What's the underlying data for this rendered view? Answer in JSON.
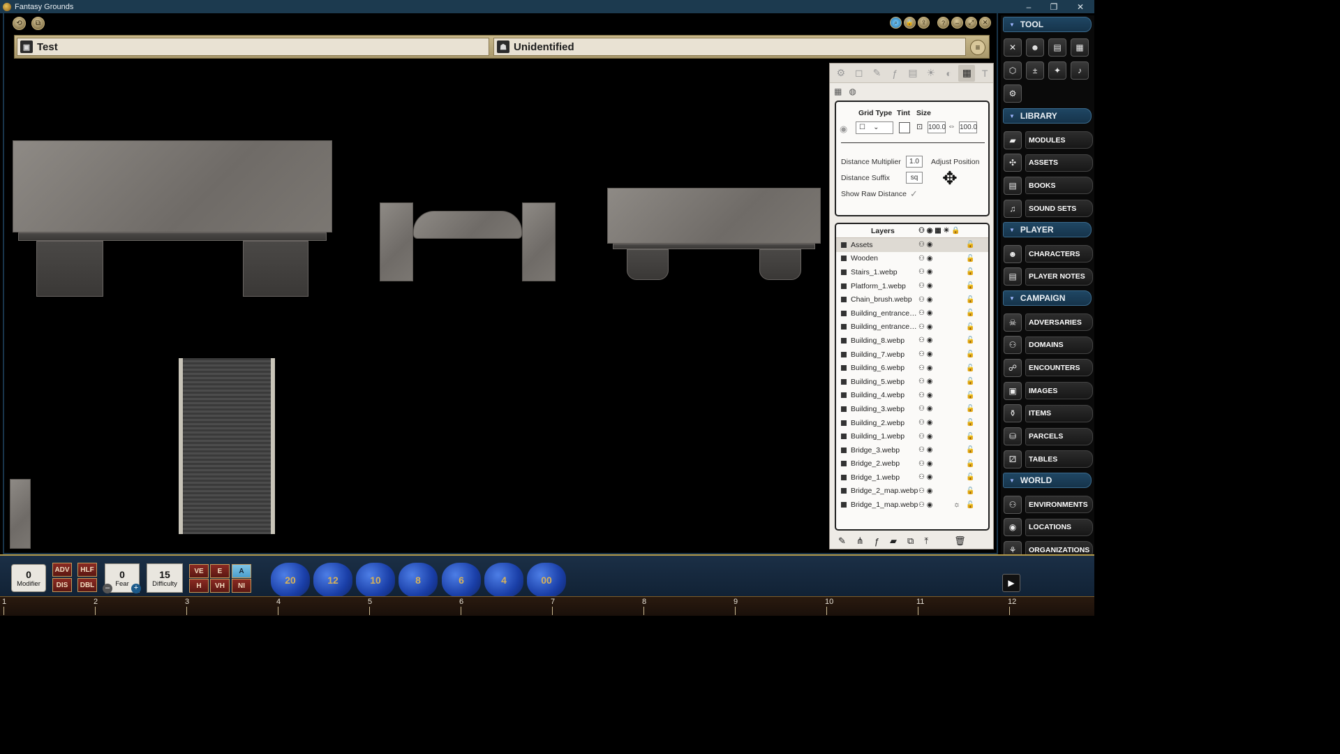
{
  "window": {
    "title": "Fantasy Grounds",
    "minimize": "–",
    "maximize": "❐",
    "close": "✕"
  },
  "header": {
    "left_name": "Test",
    "right_name": "Unidentified"
  },
  "tool_panel": {
    "grid": {
      "grid_type_label": "Grid Type",
      "tint_label": "Tint",
      "size_label": "Size",
      "size_w": "100.0",
      "size_h": "100.0",
      "distance_multiplier_label": "Distance Multiplier",
      "distance_multiplier": "1.0",
      "adjust_position_label": "Adjust Position",
      "distance_suffix_label": "Distance Suffix",
      "distance_suffix": "sq",
      "show_raw_distance_label": "Show Raw Distance",
      "show_raw_distance_checked": "✓"
    },
    "layers_title": "Layers",
    "layers": [
      "Assets",
      "Wooden",
      "Stairs_1.webp",
      "Platform_1.webp",
      "Chain_brush.webp",
      "Building_entrance_...",
      "Building_entrance_...",
      "Building_8.webp",
      "Building_7.webp",
      "Building_6.webp",
      "Building_5.webp",
      "Building_4.webp",
      "Building_3.webp",
      "Building_2.webp",
      "Building_1.webp",
      "Bridge_3.webp",
      "Bridge_2.webp",
      "Bridge_1.webp",
      "Bridge_2_map.webp",
      "Bridge_1_map.webp"
    ]
  },
  "sidebar": {
    "tool_label": "TOOL",
    "library_label": "LIBRARY",
    "library_items": [
      "MODULES",
      "ASSETS",
      "BOOKS",
      "SOUND SETS"
    ],
    "player_label": "PLAYER",
    "player_items": [
      "CHARACTERS",
      "PLAYER NOTES"
    ],
    "campaign_label": "CAMPAIGN",
    "campaign_items": [
      "ADVERSARIES",
      "DOMAINS",
      "ENCOUNTERS",
      "IMAGES",
      "ITEMS",
      "PARCELS",
      "TABLES"
    ],
    "world_label": "WORLD",
    "world_items": [
      "ENVIRONMENTS",
      "LOCATIONS",
      "ORGANIZATIONS"
    ]
  },
  "bottom": {
    "modifier_value": "0",
    "modifier_label": "Modifier",
    "adv": "ADV",
    "dis": "DIS",
    "hlf": "HLF",
    "dbl": "DBL",
    "fear_value": "0",
    "fear_label": "Fear",
    "difficulty_value": "15",
    "difficulty_label": "Difficulty",
    "ve": "VE",
    "e": "E",
    "a": "A",
    "h": "H",
    "vh": "VH",
    "ni": "NI",
    "dice": [
      "20",
      "12",
      "10",
      "8",
      "6",
      "4",
      "00"
    ]
  },
  "ruler": [
    "1",
    "2",
    "3",
    "4",
    "5",
    "6",
    "7",
    "8",
    "9",
    "10",
    "11",
    "12"
  ],
  "colors": {
    "accent": "#1c3a4f",
    "gold": "#b49a4a",
    "panel": "#eeebe6"
  }
}
